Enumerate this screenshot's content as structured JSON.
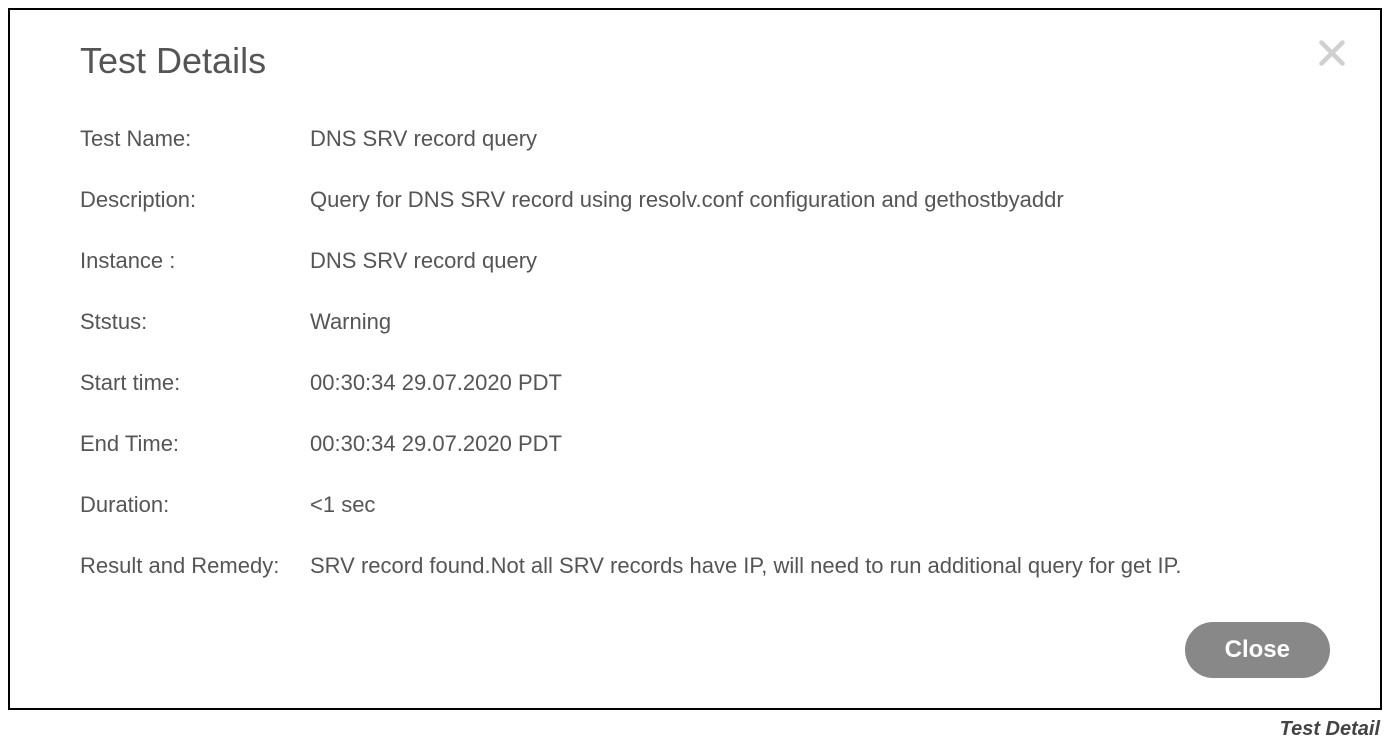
{
  "dialog": {
    "title": "Test Details",
    "rows": [
      {
        "label": "Test Name:",
        "value": "DNS SRV record query"
      },
      {
        "label": "Description:",
        "value": "Query for DNS SRV record using resolv.conf configuration and gethostbyaddr"
      },
      {
        "label": "Instance :",
        "value": "DNS SRV record query"
      },
      {
        "label": "Ststus:",
        "value": "Warning"
      },
      {
        "label": "Start time:",
        "value": "00:30:34 29.07.2020 PDT"
      },
      {
        "label": "End Time:",
        "value": "00:30:34 29.07.2020 PDT"
      },
      {
        "label": "Duration:",
        "value": "<1 sec"
      },
      {
        "label": "Result and Remedy:",
        "value": "SRV record found.Not all SRV records have IP, will need to run additional query for get IP."
      }
    ],
    "close_button": "Close"
  },
  "caption": "Test Detail"
}
